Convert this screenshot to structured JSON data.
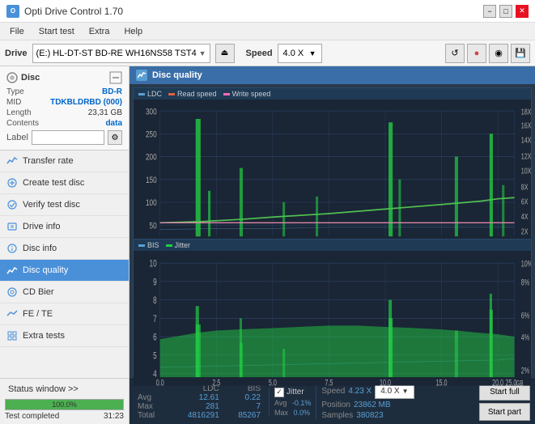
{
  "titlebar": {
    "title": "Opti Drive Control 1.70",
    "icon": "O",
    "min": "−",
    "max": "□",
    "close": "✕"
  },
  "menubar": {
    "items": [
      "File",
      "Start test",
      "Extra",
      "Help"
    ]
  },
  "drivebar": {
    "label": "Drive",
    "drive_value": "(E:)  HL-DT-ST BD-RE  WH16NS58 TST4",
    "speed_label": "Speed",
    "speed_value": "4.0 X"
  },
  "disc": {
    "title": "Disc",
    "type_label": "Type",
    "type_val": "BD-R",
    "mid_label": "MID",
    "mid_val": "TDKBLDRBD (000)",
    "length_label": "Length",
    "length_val": "23,31 GB",
    "contents_label": "Contents",
    "contents_val": "data",
    "label_label": "Label",
    "label_val": ""
  },
  "nav": {
    "items": [
      {
        "id": "transfer-rate",
        "label": "Transfer rate",
        "active": false
      },
      {
        "id": "create-test-disc",
        "label": "Create test disc",
        "active": false
      },
      {
        "id": "verify-test-disc",
        "label": "Verify test disc",
        "active": false
      },
      {
        "id": "drive-info",
        "label": "Drive info",
        "active": false
      },
      {
        "id": "disc-info",
        "label": "Disc info",
        "active": false
      },
      {
        "id": "disc-quality",
        "label": "Disc quality",
        "active": true
      },
      {
        "id": "cd-bier",
        "label": "CD Bier",
        "active": false
      },
      {
        "id": "fe-te",
        "label": "FE / TE",
        "active": false
      },
      {
        "id": "extra-tests",
        "label": "Extra tests",
        "active": false
      }
    ]
  },
  "status": {
    "window_label": "Status window >>",
    "progress": "100.0%",
    "time": "31:23",
    "completed": "Test completed"
  },
  "quality_panel": {
    "title": "Disc quality",
    "legend": {
      "ldc_label": "LDC",
      "read_label": "Read speed",
      "write_label": "Write speed"
    },
    "legend2": {
      "bis_label": "BIS",
      "jitter_label": "Jitter"
    },
    "xaxis_max": "25.0",
    "xaxis_unit": "GB",
    "yaxis1_max": "300",
    "yaxis1_right_max": "18X",
    "yaxis2_max": "10",
    "yaxis2_right_max": "10%"
  },
  "stats": {
    "headers": [
      "",
      "LDC",
      "BIS",
      "",
      "Jitter",
      "Speed",
      ""
    ],
    "avg_label": "Avg",
    "avg_ldc": "12.61",
    "avg_bis": "0.22",
    "avg_jitter": "-0.1%",
    "max_label": "Max",
    "max_ldc": "281",
    "max_bis": "7",
    "max_jitter": "0.0%",
    "total_label": "Total",
    "total_ldc": "4816291",
    "total_bis": "85267",
    "speed_label": "Speed",
    "speed_val": "4.23 X",
    "speed_select": "4.0 X",
    "position_label": "Position",
    "position_val": "23862 MB",
    "samples_label": "Samples",
    "samples_val": "380823",
    "jitter_checked": true,
    "jitter_label": "Jitter",
    "start_full_label": "Start full",
    "start_part_label": "Start part"
  }
}
